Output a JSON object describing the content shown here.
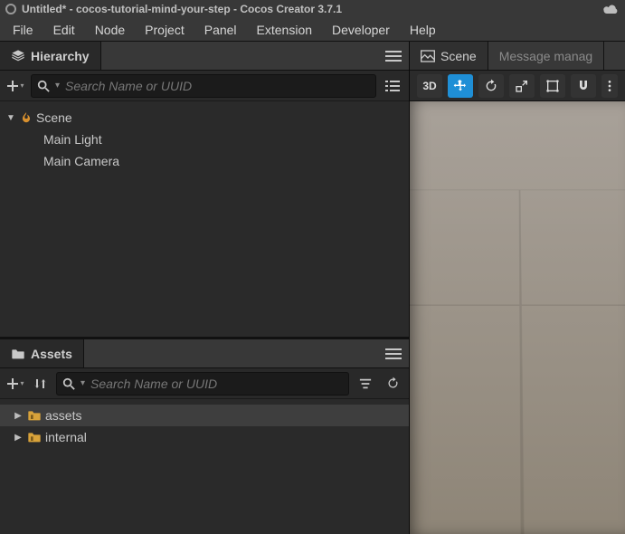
{
  "window": {
    "title": "Untitled* - cocos-tutorial-mind-your-step - Cocos Creator 3.7.1"
  },
  "menubar": {
    "items": [
      "File",
      "Edit",
      "Node",
      "Project",
      "Panel",
      "Extension",
      "Developer",
      "Help"
    ]
  },
  "left": {
    "hierarchy": {
      "tab_label": "Hierarchy",
      "search_placeholder": "Search Name or UUID",
      "nodes": {
        "root": "Scene",
        "children": [
          "Main Light",
          "Main Camera"
        ]
      }
    },
    "assets": {
      "tab_label": "Assets",
      "search_placeholder": "Search Name or UUID",
      "folders": [
        "assets",
        "internal"
      ]
    }
  },
  "right": {
    "tabs": {
      "scene": "Scene",
      "message_manager": "Message manag"
    },
    "toolbar": {
      "btn_3d": "3D"
    }
  }
}
